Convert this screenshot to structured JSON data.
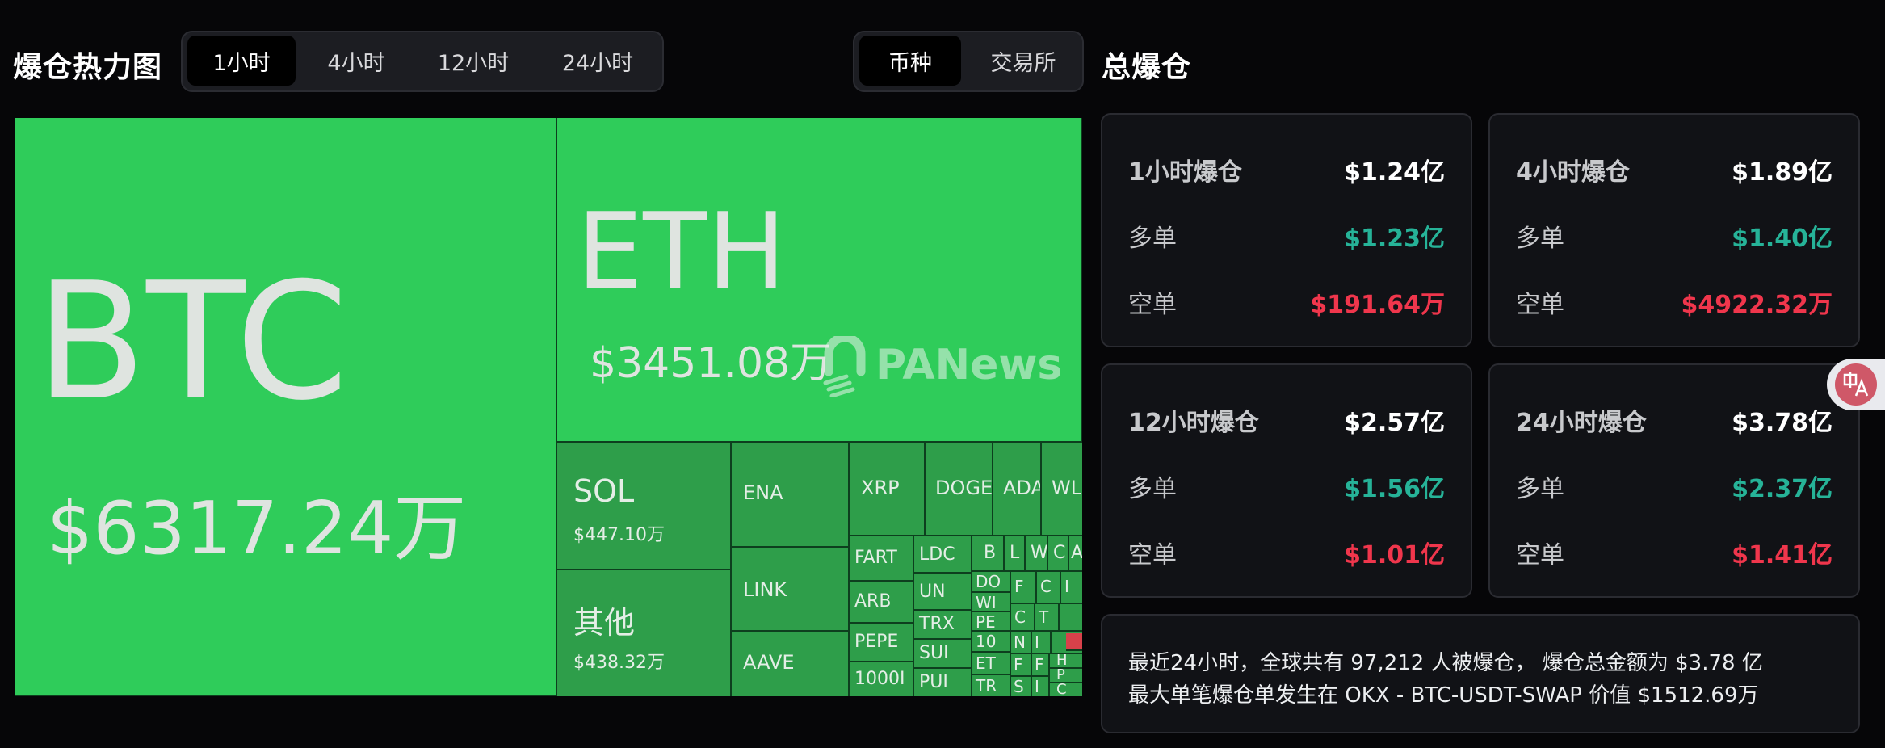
{
  "header": {
    "heatmap_title": "爆仓热力图",
    "time_tabs": [
      "1小时",
      "4小时",
      "12小时",
      "24小时"
    ],
    "active_time_tab": "1小时",
    "group_tabs": [
      "币种",
      "交易所"
    ],
    "active_group_tab": "币种",
    "summary_title": "总爆仓"
  },
  "heatmap": {
    "big": {
      "btc": {
        "name": "BTC",
        "value": "$6317.24万"
      },
      "eth": {
        "name": "ETH",
        "value": "$3451.08万"
      },
      "sol": {
        "name": "SOL",
        "value": "$447.10万"
      },
      "other": {
        "name": "其他",
        "value": "$438.32万"
      }
    },
    "named": [
      "ENA",
      "LINK",
      "AAVE",
      "XRP",
      "DOGE",
      "ADA",
      "WL",
      "FART",
      "ARB",
      "PEPE",
      "1000I",
      "LDC",
      "UN",
      "TRX",
      "SUI",
      "PUI"
    ],
    "micro": [
      "B",
      "L",
      "W",
      "C",
      "A",
      "DO",
      "WI",
      "PE",
      "10",
      "ET",
      "TR",
      "F",
      "C",
      "I",
      "C",
      "T",
      "N",
      "I",
      "F",
      "S",
      "F",
      "I",
      "H",
      "P",
      "C"
    ],
    "watermark": "PANews",
    "colors": {
      "bright": "#2fcc5a",
      "mid": "#2e9e4a",
      "border": "#0d3f1e",
      "red_tile": "#d8414a"
    }
  },
  "summary": {
    "cards": [
      {
        "title": "1小时爆仓",
        "total": "$1.24亿",
        "long_label": "多单",
        "long": "$1.23亿",
        "short_label": "空单",
        "short": "$191.64万"
      },
      {
        "title": "4小时爆仓",
        "total": "$1.89亿",
        "long_label": "多单",
        "long": "$1.40亿",
        "short_label": "空单",
        "short": "$4922.32万"
      },
      {
        "title": "12小时爆仓",
        "total": "$2.57亿",
        "long_label": "多单",
        "long": "$1.56亿",
        "short_label": "空单",
        "short": "$1.01亿"
      },
      {
        "title": "24小时爆仓",
        "total": "$3.78亿",
        "long_label": "多单",
        "long": "$2.37亿",
        "short_label": "空单",
        "short": "$1.41亿"
      }
    ],
    "notice_line1": "最近24小时，全球共有 97,212 人被爆仓， 爆仓总金额为 $3.78 亿",
    "notice_line2": "最大单笔爆仓单发生在 OKX - BTC-USDT-SWAP 价值 $1512.69万"
  },
  "colors": {
    "green": "#26b398",
    "red": "#f0364c",
    "background": "#060608"
  },
  "floating": {
    "icon": "translate-icon"
  }
}
